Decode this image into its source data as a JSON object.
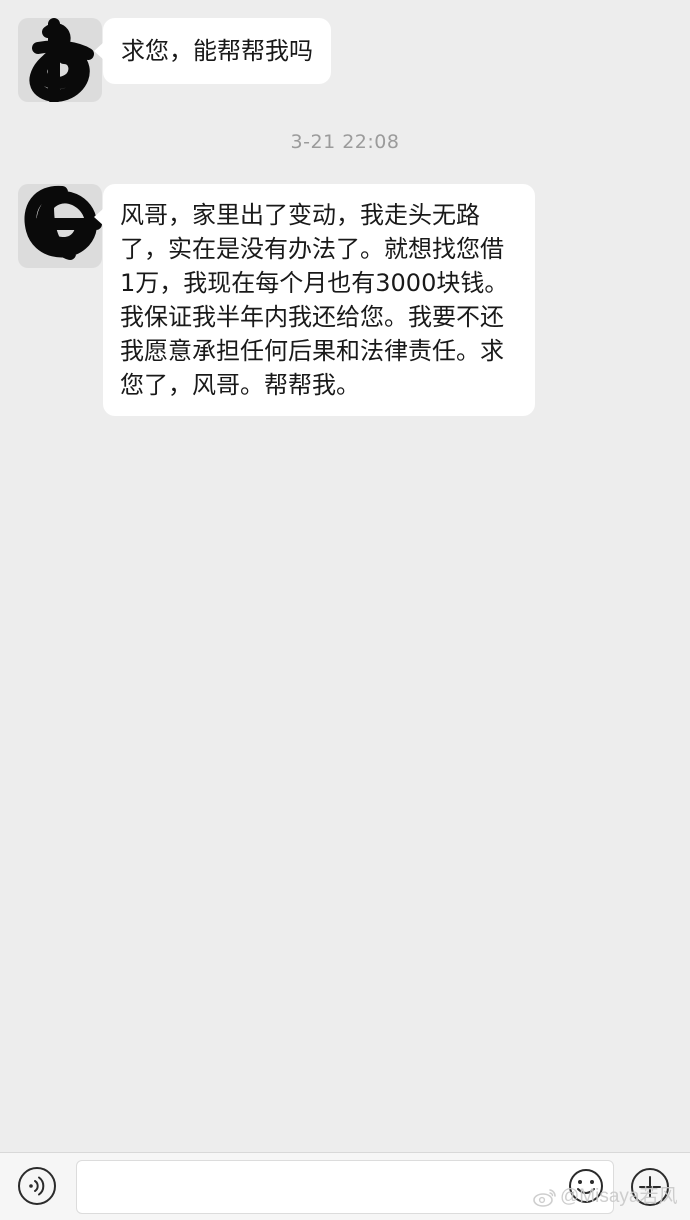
{
  "messages": [
    {
      "sender": "contact",
      "text": "求您，能帮帮我吗"
    },
    {
      "sender": "contact",
      "text": "风哥，家里出了变动，我走头无路了，实在是没有办法了。就想找您借1万，我现在每个月也有3000块钱。我保证我半年内我还给您。我要不还我愿意承担任何后果和法律责任。求您了，风哥。帮帮我。"
    }
  ],
  "timestamp": "3-21 22:08",
  "input_bar": {
    "text_value": "",
    "voice_icon": "voice-icon",
    "emoji_icon": "emoji-icon",
    "plus_icon": "plus-icon"
  },
  "watermark": {
    "text": "@Misaya若风",
    "logo_icon": "weibo-icon"
  },
  "colors": {
    "background": "#ededed",
    "bubble": "#ffffff",
    "timestamp": "#9b9b9b",
    "input_bar": "#f6f6f6"
  }
}
